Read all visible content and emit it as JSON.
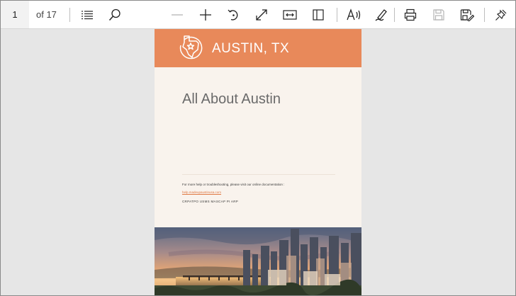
{
  "toolbar": {
    "page_number": "1",
    "page_count": "of 17",
    "buttons": [
      {
        "name": "contents",
        "icon": "list-icon"
      },
      {
        "name": "find",
        "icon": "search-icon"
      },
      {
        "name": "zoom-out",
        "icon": "minus-icon"
      },
      {
        "name": "zoom-in",
        "icon": "plus-icon"
      },
      {
        "name": "rotate",
        "icon": "rotate-icon"
      },
      {
        "name": "fit",
        "icon": "expand-icon"
      },
      {
        "name": "fit-width",
        "icon": "fit-width-icon"
      },
      {
        "name": "page-view",
        "icon": "page-view-icon"
      },
      {
        "name": "read-aloud",
        "icon": "read-aloud-icon"
      },
      {
        "name": "draw",
        "icon": "pen-icon"
      },
      {
        "name": "print",
        "icon": "printer-icon"
      },
      {
        "name": "save",
        "icon": "save-icon"
      },
      {
        "name": "save-as",
        "icon": "save-as-icon"
      },
      {
        "name": "pin",
        "icon": "pin-icon"
      }
    ]
  },
  "document": {
    "banner_title": "AUSTIN, TX",
    "heading": "All About Austin",
    "help_text": "For more help or troubleshooting, please visit our online documentation :",
    "help_link": "help.madeupaustinusa.com",
    "caps_line": "CRPATPO USMS MASCAP PI ARP"
  },
  "colors": {
    "banner": "#e8895a",
    "page": "#f9f3ed",
    "link": "#e07a45",
    "viewer_bg": "#e6e6e6"
  }
}
